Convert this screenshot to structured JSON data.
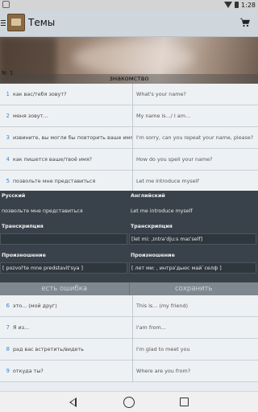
{
  "status_bar": {
    "time": "1:28"
  },
  "app_bar": {
    "title": "Темы"
  },
  "banner": {
    "lesson_number": "N: 1",
    "lesson_title": "знакомство"
  },
  "phrases": [
    {
      "num": "1",
      "ru": "как вас/тебя зовут?",
      "en": "What's your name?"
    },
    {
      "num": "2",
      "ru": "меня зовут...",
      "en": "My name is.../ I am..."
    },
    {
      "num": "3",
      "ru": "извините, вы могли бы повторить ваше имя",
      "en": "I'm sorry, can you repeat your name, please?"
    },
    {
      "num": "4",
      "ru": "как пишется ваше/твоё имя?",
      "en": "How do you spell your name?"
    },
    {
      "num": "5",
      "ru": "позвольте мне представиться",
      "en": "Let me introduce myself"
    }
  ],
  "detail": {
    "ru_header": "Русский",
    "ru_text": "позвольте мне представиться",
    "en_header": "Английский",
    "en_text": "Let me introduce myself",
    "ru_transcription_header": "Транскрипция",
    "ru_transcription": "",
    "en_transcription_header": "Транскрипция",
    "en_transcription": "[let miː ˌɪntrəˈdjuːs maɪˈself]",
    "ru_pron_header": "Произношение",
    "ru_pron": "[ pozvol'te mne predstavit'sya ]",
    "en_pron_header": "Произношение",
    "en_pron": "[ лет миː ˌ интрэˈдьюс май`селф ]",
    "report_error": "есть ошибка",
    "save": "сохранить"
  },
  "phrases_more": [
    {
      "num": "6",
      "ru": "это... (мой друг)",
      "en": "This is... (my friend)"
    },
    {
      "num": "7",
      "ru": "Я из...",
      "en": "I'am from..."
    },
    {
      "num": "8",
      "ru": "рад вас встретить/видеть",
      "en": "I'm glad to meet you"
    },
    {
      "num": "9",
      "ru": "откуда ты?",
      "en": "Where are you from?"
    }
  ],
  "icons": {
    "menu": "menu-icon",
    "logo": "app-logo-icon",
    "cart": "cart-icon",
    "back": "back-icon",
    "home": "home-icon",
    "recents": "recents-icon"
  },
  "colors": {
    "accent_number": "#3a8ad3",
    "detail_background": "#39424a",
    "action_bar": "#7f878f"
  }
}
